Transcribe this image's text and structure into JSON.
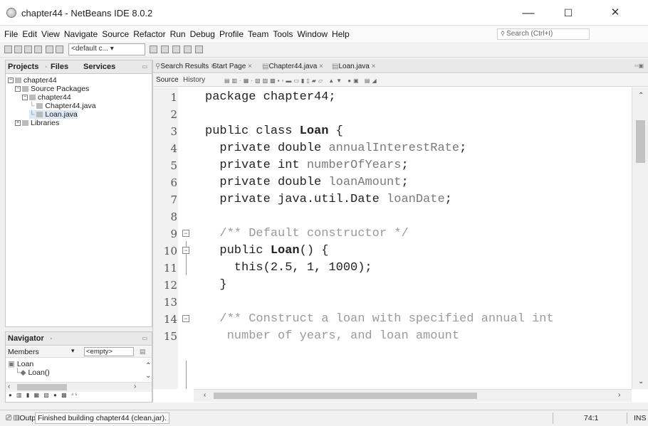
{
  "window": {
    "title": "chapter44 - NetBeans IDE 8.0.2",
    "minimize": "—",
    "maximize": "☐",
    "close": "✕"
  },
  "menu": [
    "File",
    "Edit",
    "View",
    "Navigate",
    "Source",
    "Refactor",
    "Run",
    "Debug",
    "Profile",
    "Team",
    "Tools",
    "Window",
    "Help"
  ],
  "search": {
    "placeholder": "Search (Ctrl+I)"
  },
  "toolbar": {
    "config": "<default c..."
  },
  "projects_pane": {
    "tabs": [
      "Projects",
      "Files",
      "Services"
    ],
    "tree": [
      {
        "label": "chapter44",
        "level": 0,
        "twisty": "−"
      },
      {
        "label": "Source Packages",
        "level": 1,
        "twisty": "−"
      },
      {
        "label": "chapter44",
        "level": 2,
        "twisty": "−"
      },
      {
        "label": "Chapter44.java",
        "level": 3,
        "twisty": ""
      },
      {
        "label": "Loan.java",
        "level": 3,
        "twisty": "",
        "selected": true
      },
      {
        "label": "Libraries",
        "level": 1,
        "twisty": "+"
      }
    ]
  },
  "navigator": {
    "title": "Navigator",
    "members_label": "Members",
    "filter": "<empty>",
    "tree": [
      {
        "label": "Loan",
        "level": 0
      },
      {
        "label": "Loan()",
        "level": 1
      }
    ]
  },
  "editor": {
    "tabs": [
      "Search Results",
      "Start Page",
      "Chapter44.java",
      "Loan.java"
    ],
    "active_tab": "Loan.java",
    "view_tabs": [
      "Source",
      "History"
    ],
    "lines": [
      {
        "n": "1",
        "text": "package chapter44;"
      },
      {
        "n": "2",
        "text": ""
      },
      {
        "n": "3",
        "text": "public class Loan {"
      },
      {
        "n": "4",
        "text": "  private double annualInterestRate;"
      },
      {
        "n": "5",
        "text": "  private int numberOfYears;"
      },
      {
        "n": "6",
        "text": "  private double loanAmount;"
      },
      {
        "n": "7",
        "text": "  private java.util.Date loanDate;"
      },
      {
        "n": "8",
        "text": ""
      },
      {
        "n": "9",
        "text": "  /** Default constructor */"
      },
      {
        "n": "10",
        "text": "  public Loan() {"
      },
      {
        "n": "11",
        "text": "    this(2.5, 1, 1000);"
      },
      {
        "n": "12",
        "text": "  }"
      },
      {
        "n": "13",
        "text": ""
      },
      {
        "n": "14",
        "text": "  /** Construct a loan with specified annual int"
      },
      {
        "n": "15",
        "text": "   number of years, and loan amount"
      }
    ]
  },
  "status": {
    "output_label": "Output",
    "message": "Finished building chapter44 (clean,jar).",
    "position": "74:1",
    "mode": "INS"
  }
}
